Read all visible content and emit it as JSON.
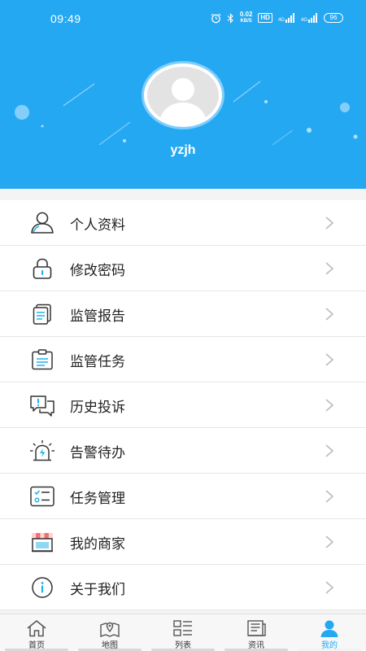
{
  "status_bar": {
    "time": "09:49",
    "net_speed_value": "0.02",
    "net_speed_unit": "KB/S",
    "hd_label": "HD",
    "signal_1": "4G",
    "signal_2": "4G",
    "battery": "96"
  },
  "profile": {
    "username": "yzjh"
  },
  "menu": {
    "items": [
      {
        "label": "个人资料",
        "icon": "user-profile-icon"
      },
      {
        "label": "修改密码",
        "icon": "lock-icon"
      },
      {
        "label": "监管报告",
        "icon": "report-icon"
      },
      {
        "label": "监管任务",
        "icon": "clipboard-icon"
      },
      {
        "label": "历史投诉",
        "icon": "complaint-icon"
      },
      {
        "label": "告警待办",
        "icon": "alarm-icon"
      },
      {
        "label": "任务管理",
        "icon": "task-list-icon"
      },
      {
        "label": "我的商家",
        "icon": "store-icon"
      },
      {
        "label": "关于我们",
        "icon": "info-icon"
      }
    ]
  },
  "tabbar": {
    "tabs": [
      {
        "label": "首页",
        "icon": "home-icon",
        "active": false
      },
      {
        "label": "地图",
        "icon": "map-icon",
        "active": false
      },
      {
        "label": "列表",
        "icon": "list-icon",
        "active": false
      },
      {
        "label": "资讯",
        "icon": "news-icon",
        "active": false
      },
      {
        "label": "我的",
        "icon": "person-icon",
        "active": true
      }
    ]
  },
  "colors": {
    "header_bg": "#25a8f2",
    "accent": "#25a8f2",
    "alert_icon": "#1fb2e8"
  }
}
